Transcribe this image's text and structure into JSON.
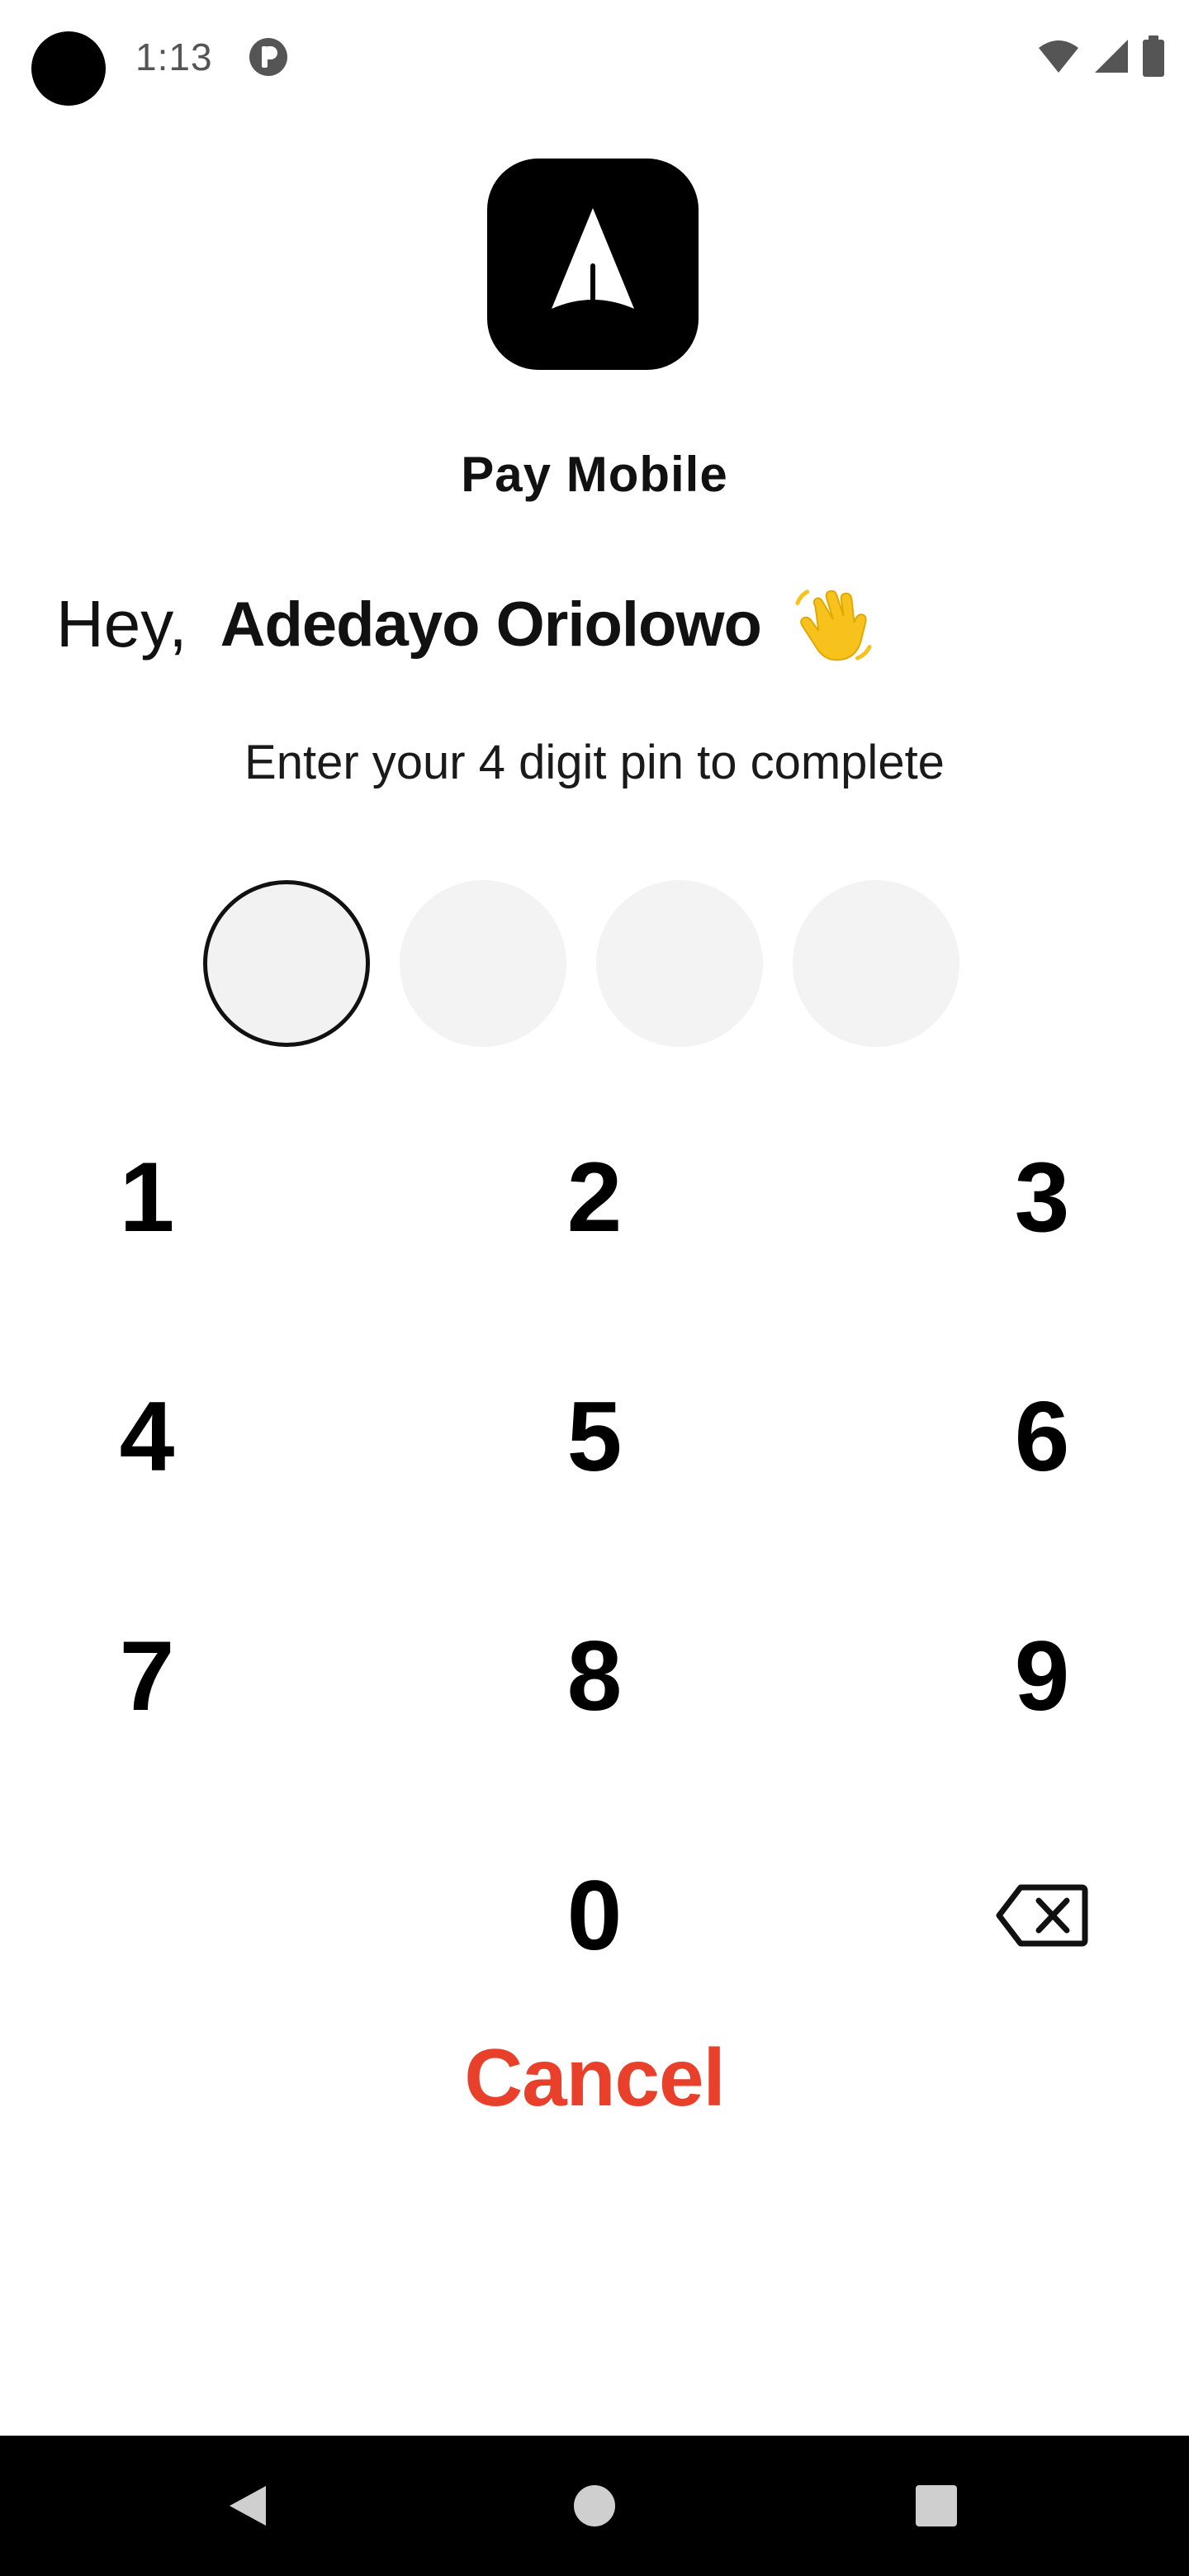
{
  "status_bar": {
    "time": "1:13",
    "icons": [
      "app-notification-icon",
      "wifi-icon",
      "signal-icon",
      "battery-icon"
    ]
  },
  "app": {
    "logo_icon": "arrow-up-logo-icon",
    "title": "Pay Mobile"
  },
  "greeting": {
    "hey": "Hey,",
    "name": "Adedayo Oriolowo",
    "icon": "waving-hand-icon"
  },
  "instruction": "Enter your 4 digit pin to complete",
  "pin": {
    "length": 4,
    "entered": 0,
    "active_index": 0
  },
  "keypad": {
    "keys": [
      "1",
      "2",
      "3",
      "4",
      "5",
      "6",
      "7",
      "8",
      "9",
      "0"
    ],
    "backspace_icon": "backspace-icon"
  },
  "cancel_label": "Cancel",
  "colors": {
    "accent_cancel": "#e8402b",
    "wave_emoji": "#f7c21b",
    "pin_empty": "#f3f3f3",
    "nav_bar": "#000000"
  },
  "nav_bar": {
    "icons": [
      "back-icon",
      "home-icon",
      "recents-icon"
    ]
  }
}
